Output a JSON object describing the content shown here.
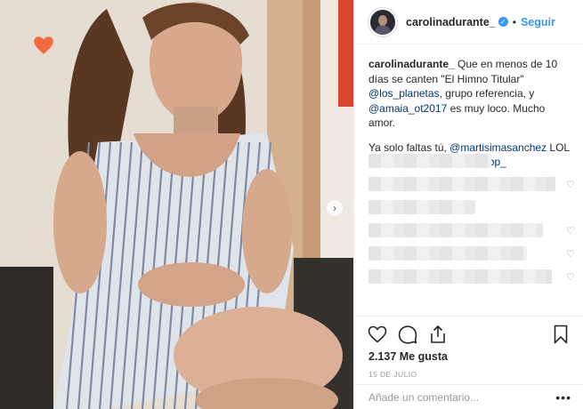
{
  "post": {
    "username": "carolinadurante_",
    "verified_icon": "verified-badge-icon",
    "separator": "•",
    "follow_label": "Seguir"
  },
  "caption": {
    "user": "carolinadurante_",
    "text1": " Que en menos de 10 días se canten \"El Himno Titular\" ",
    "mention1": "@los_planetas",
    "text2": ", grupo referencia, y ",
    "mention2": "@amaia_ot2017",
    "text3": " es muy loco. Mucho amor.",
    "line2_text1": "Ya solo faltas tú, ",
    "mention3": "@martisimasanchez",
    "line2_text2": " LOL NO🔪🖤 vídeo de ",
    "mention4": "@el_flop_"
  },
  "comments": [
    {
      "blur_width": 138,
      "liked_icon": ""
    },
    {
      "blur_width": 210,
      "liked_icon": "heart-outline-icon"
    },
    {
      "blur_width": 120,
      "liked_icon": ""
    },
    {
      "blur_width": 196,
      "liked_icon": "heart-outline-icon"
    },
    {
      "blur_width": 178,
      "liked_icon": "heart-outline-icon"
    },
    {
      "blur_width": 206,
      "liked_icon": "heart-outline-icon"
    }
  ],
  "actions": {
    "like_icon": "heart-outline-icon",
    "comment_icon": "comment-bubble-icon",
    "share_icon": "share-icon",
    "save_icon": "bookmark-icon"
  },
  "likes": "2.137 Me gusta",
  "date": "15 DE JULIO",
  "comment_box": {
    "placeholder": "Añade un comentario...",
    "more_label": "•••"
  },
  "media": {
    "sticker_icon": "heart-sticker-icon",
    "next_icon": "chevron-right-icon"
  },
  "colors": {
    "accent": "#3897f0",
    "mention": "#003569",
    "muted": "#999999"
  }
}
